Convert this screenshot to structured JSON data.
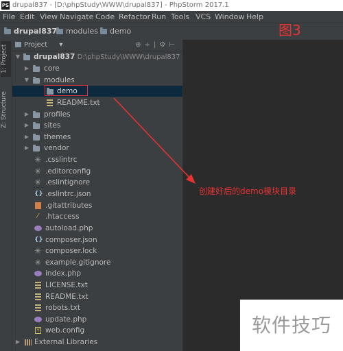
{
  "titlebar": {
    "logo": "PS",
    "title": "drupal837 - [D:\\phpStudy\\WWW\\drupal837] - PhpStorm 2017.1"
  },
  "menu": {
    "items": [
      "File",
      "Edit",
      "View",
      "Navigate",
      "Code",
      "Refactor",
      "Run",
      "Tools",
      "VCS",
      "Window",
      "Help"
    ]
  },
  "breadcrumb": {
    "items": [
      "drupal837",
      "modules",
      "demo"
    ]
  },
  "figure_label": "图3",
  "stripe": {
    "project_tab": "1: Project",
    "structure_tab": "Z: Structure"
  },
  "panel": {
    "title": "Project",
    "icons": [
      "globe-icon",
      "split-icon",
      "gear-icon",
      "hide-icon"
    ]
  },
  "tree": {
    "root": {
      "name": "drupal837",
      "path": "D:\\phpStudy\\WWW\\drupal837"
    },
    "items": [
      {
        "label": "core"
      },
      {
        "label": "modules"
      },
      {
        "label": "demo"
      },
      {
        "label": "README.txt"
      },
      {
        "label": "profiles"
      },
      {
        "label": "sites"
      },
      {
        "label": "themes"
      },
      {
        "label": "vendor"
      },
      {
        "label": ".csslintrc"
      },
      {
        "label": ".editorconfig"
      },
      {
        "label": ".eslintignore"
      },
      {
        "label": ".eslintrc.json"
      },
      {
        "label": ".gitattributes"
      },
      {
        "label": ".htaccess"
      },
      {
        "label": "autoload.php"
      },
      {
        "label": "composer.json"
      },
      {
        "label": "composer.lock"
      },
      {
        "label": "example.gitignore"
      },
      {
        "label": "index.php"
      },
      {
        "label": "LICENSE.txt"
      },
      {
        "label": "README.txt"
      },
      {
        "label": "robots.txt"
      },
      {
        "label": "update.php"
      },
      {
        "label": "web.config"
      }
    ],
    "external_libraries": "External Libraries"
  },
  "annotation": "创建好后的demo模块目录",
  "watermark": "软件技巧",
  "colors": {
    "accent_red": "#e53333",
    "selection": "#0d293e",
    "panel_bg": "#3c3f41",
    "editor_bg": "#2b2b2b"
  }
}
